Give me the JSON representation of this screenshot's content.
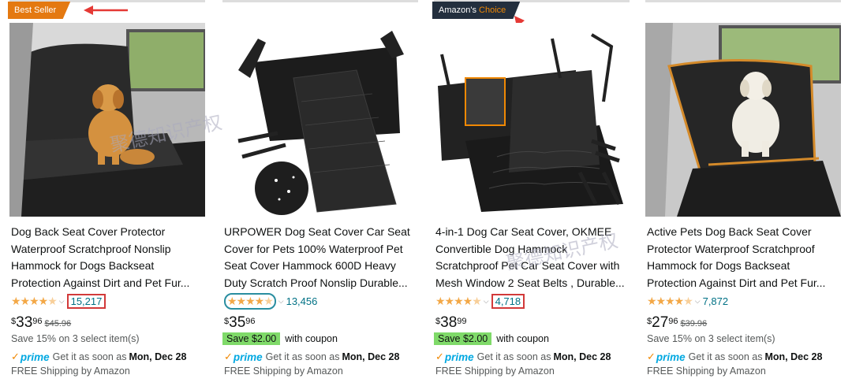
{
  "watermark": "聚德知识产权",
  "products": [
    {
      "badge": "Best Seller",
      "title": "Dog Back Seat Cover Protector Waterproof Scratchproof Nonslip Hammock for Dogs Backseat Protection Against Dirt and Pet Fur...",
      "rating": 4.5,
      "review_count": "15,217",
      "price_symbol": "$",
      "price_whole": "33",
      "price_fraction": "96",
      "list_price": "$45.96",
      "savings_text": "Save 15% on 3 select item(s)",
      "prime_label": "prime",
      "delivery_text": "Get it as soon as",
      "delivery_date": "Mon, Dec 28",
      "shipping_text": "FREE Shipping by Amazon"
    },
    {
      "title": "URPOWER Dog Seat Cover Car Seat Cover for Pets 100% Waterproof Pet Seat Cover Hammock 600D Heavy Duty Scratch Proof Nonslip Durable...",
      "rating": 4.5,
      "review_count": "13,456",
      "price_symbol": "$",
      "price_whole": "35",
      "price_fraction": "96",
      "coupon_tag": "Save $2.00",
      "coupon_text": "with coupon",
      "prime_label": "prime",
      "delivery_text": "Get it as soon as",
      "delivery_date": "Mon, Dec 28",
      "shipping_text": "FREE Shipping by Amazon"
    },
    {
      "badge_prefix": "Amazon's",
      "badge_suffix": "Choice",
      "title": "4-in-1 Dog Car Seat Cover, OKMEE Convertible Dog Hammock Scratchproof Pet Car Seat Cover with Mesh Window 2 Seat Belts , Durable...",
      "rating": 4.5,
      "review_count": "4,718",
      "price_symbol": "$",
      "price_whole": "38",
      "price_fraction": "99",
      "coupon_tag": "Save $2.00",
      "coupon_text": "with coupon",
      "prime_label": "prime",
      "delivery_text": "Get it as soon as",
      "delivery_date": "Mon, Dec 28",
      "shipping_text": "FREE Shipping by Amazon"
    },
    {
      "title": "Active Pets Dog Back Seat Cover Protector Waterproof Scratchproof Hammock for Dogs Backseat Protection Against Dirt and Pet Fur...",
      "rating": 4.5,
      "review_count": "7,872",
      "price_symbol": "$",
      "price_whole": "27",
      "price_fraction": "96",
      "list_price": "$39.96",
      "savings_text": "Save 15% on 3 select item(s)",
      "prime_label": "prime",
      "delivery_text": "Get it as soon as",
      "delivery_date": "Mon, Dec 28",
      "shipping_text": "FREE Shipping by Amazon"
    }
  ],
  "colors": {
    "best_seller": "#e47911",
    "amazons_choice": "#232f3e",
    "star": "#f3a847",
    "link": "#007185",
    "coupon": "#7fda69",
    "prime": "#00a8e1",
    "annotation": "#d23a3a"
  }
}
